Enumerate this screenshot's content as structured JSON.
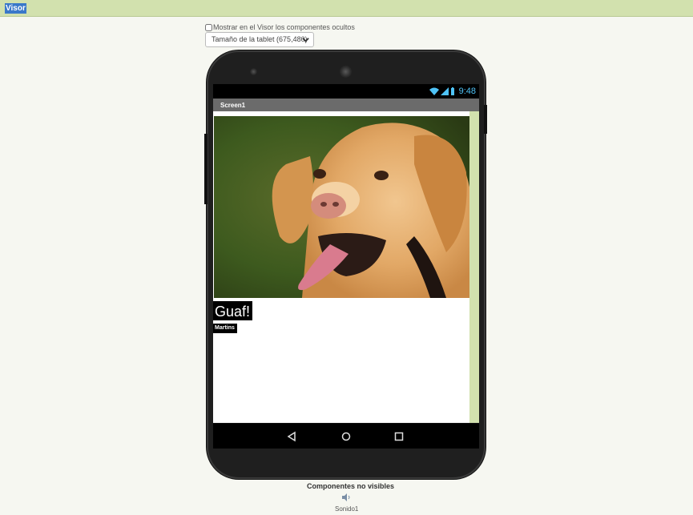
{
  "header": {
    "title": "Visor"
  },
  "options": {
    "show_hidden_label": "Mostrar en el Visor los componentes ocultos",
    "show_hidden_checked": false,
    "preview_size": "Tamaño de la tablet (675,480)"
  },
  "device": {
    "status_time": "9:48",
    "screen_title": "Screen1",
    "components": {
      "image_alt": "dog photo",
      "label_big": "Guaf!",
      "label_small": "Martins"
    }
  },
  "non_visible": {
    "title": "Componentes no visibles",
    "items": [
      {
        "label": "Sonido1",
        "icon": "speaker-icon"
      }
    ]
  },
  "colors": {
    "header_bg": "#d2e1ae",
    "selection": "#3a78c9",
    "status_accent": "#4fc3f7",
    "title_bar": "#6b6b6b"
  }
}
